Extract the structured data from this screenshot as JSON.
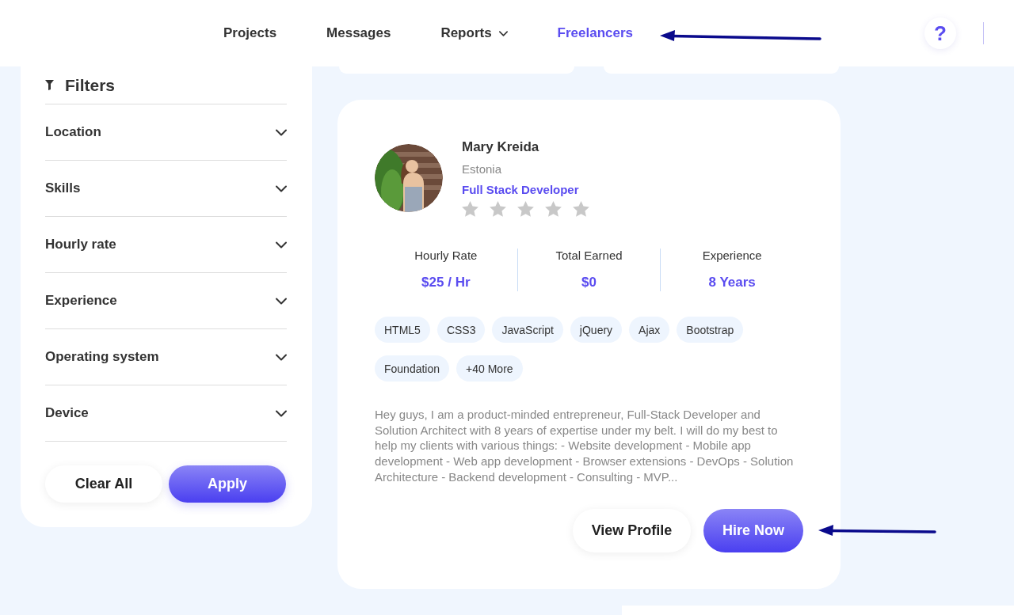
{
  "nav": {
    "items": [
      {
        "label": "Projects",
        "kind": "link",
        "selected": false
      },
      {
        "label": "Messages",
        "kind": "link",
        "selected": false
      },
      {
        "label": "Reports",
        "kind": "dropdown",
        "selected": false
      },
      {
        "label": "Freelancers",
        "kind": "link",
        "selected": true
      }
    ],
    "help_button": "?"
  },
  "filters": {
    "title": "Filters",
    "items": [
      {
        "label": "Location",
        "expanded": false
      },
      {
        "label": "Skills",
        "expanded": false
      },
      {
        "label": "Hourly rate",
        "expanded": false
      },
      {
        "label": "Experience",
        "expanded": false
      },
      {
        "label": "Operating system",
        "expanded": false
      },
      {
        "label": "Device",
        "expanded": false
      }
    ],
    "buttons": [
      {
        "label": "Clear All",
        "kind": "secondary"
      },
      {
        "label": "Apply",
        "kind": "primary"
      }
    ]
  },
  "freelancer": {
    "name": "Mary Kreida",
    "location": "Estonia",
    "title": "Full Stack Developer",
    "stars": 0,
    "stats": [
      {
        "label": "Hourly Rate",
        "value": "$25 / Hr"
      },
      {
        "label": "Total Earned",
        "value": "$0"
      },
      {
        "label": "Experience",
        "value": "8 Years"
      }
    ],
    "skills": [
      "HTML5",
      "CSS3",
      "JavaScript",
      "jQuery",
      "Ajax",
      "Bootstrap",
      "Foundation",
      "+40 More"
    ],
    "description": "Hey guys, I am a product-minded entrepreneur, Full-Stack Developer and Solution Architect with 8 years of expertise under my belt. I will do my best to help my clients with various things: - Website development - Mobile app development - Web app development - Browser extensions - DevOps - Solution Architecture - Backend development - Consulting - MVP...",
    "buttons": [
      {
        "label": "View Profile",
        "kind": "secondary"
      },
      {
        "label": "Hire Now",
        "kind": "primary"
      }
    ]
  }
}
